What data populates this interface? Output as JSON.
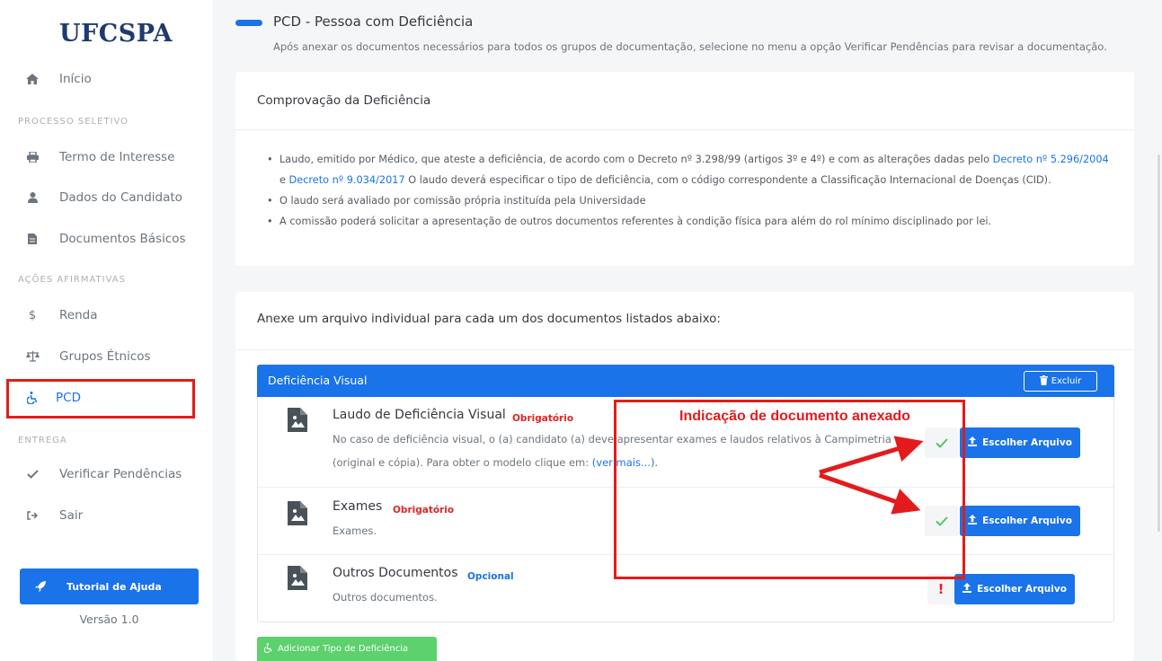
{
  "sidebar": {
    "logo": "UFCSPA",
    "home": "Início",
    "section_processo": "PROCESSO SELETIVO",
    "termo": "Termo de Interesse",
    "dados": "Dados do Candidato",
    "documentos": "Documentos Básicos",
    "section_acoes": "AÇÕES AFIRMATIVAS",
    "renda": "Renda",
    "grupos": "Grupos Étnicos",
    "pcd": "PCD",
    "section_entrega": "ENTREGA",
    "verificar": "Verificar Pendências",
    "sair": "Sair",
    "tutorial": "Tutorial de Ajuda",
    "version": "Versão 1.0",
    "renda_icon_text": "$"
  },
  "header": {
    "title": "PCD - Pessoa com Deficiência",
    "subtitle": "Após anexar os documentos necessários para todos os grupos de documentação, selecione no menu a opção Verificar Pendências para revisar a documentação."
  },
  "comprovacao": {
    "title": "Comprovação da Deficiência",
    "b1_part1": "Laudo, emitido por Médico, que ateste a deficiência, de acordo com o Decreto nº 3.298/99 (artigos 3º e 4º) e com as alterações dadas pelo ",
    "b1_link1": "Decreto nº 5.296/2004",
    "b1_part2": "e ",
    "b1_link2": "Decreto nº 9.034/2017",
    "b1_part3": " O laudo deverá especificar o tipo de deficiência, com o código correspondente a Classificação Internacional de Doenças (CID).",
    "b2": "O laudo será avaliado por comissão própria instituída pela Universidade",
    "b3": "A comissão poderá solicitar a apresentação de outros documentos referentes à condição física para além do rol mínimo disciplinado por lei."
  },
  "anexe": {
    "instruction": "Anexe um arquivo individual para cada um dos documentos listados abaixo:",
    "panel_title": "Deficiência Visual",
    "excluir": "Excluir",
    "upload_label": "Escolher Arquivo",
    "add_type": "Adicionar Tipo de Deficiência"
  },
  "docs": [
    {
      "title": "Laudo de Deficiência Visual",
      "badge": "Obrigatório",
      "desc_line1": "No caso de deficiência visual, o (a) candidato (a) deve apresentar exames e laudos relativos à Campimetria",
      "desc_line2": "(original e cópia). Para obter o modelo clique em: ",
      "desc_link": "(ver mais...)",
      "desc_end": ".",
      "status": "attached"
    },
    {
      "title": "Exames",
      "badge": "Obrigatório",
      "desc": "Exames.",
      "status": "attached"
    },
    {
      "title": "Outros Documentos",
      "badge": "Opcional",
      "desc": "Outros documentos.",
      "status": "missing",
      "status_mark": "!"
    }
  ],
  "annotation": {
    "label": "Indicação de documento anexado"
  },
  "colors": {
    "primary": "#1a73e8",
    "success": "#4cc763",
    "danger": "#e02424",
    "annotation": "#e41b1b",
    "logo": "#1e3a6e"
  },
  "icons": {
    "home": "home-icon",
    "termo": "printer-icon",
    "dados": "user-icon",
    "documentos": "file-icon",
    "renda": "dollar-icon",
    "grupos": "balance-scale-icon",
    "pcd": "wheelchair-icon",
    "verificar": "check-icon",
    "sair": "sign-out-icon",
    "tutorial": "rocket-icon"
  }
}
